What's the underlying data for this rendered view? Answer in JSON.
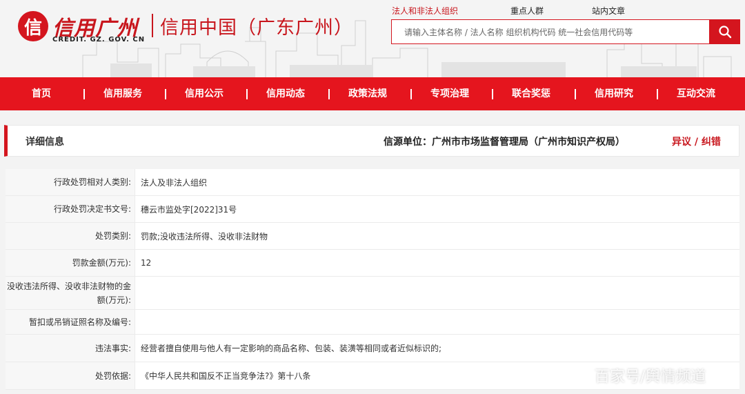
{
  "header": {
    "logo_mark": "信",
    "logo_text": "信用广州",
    "logo_sub": "信用中国（广东广州）",
    "logo_domain": "CREDIT. GZ. GOV. CN"
  },
  "search": {
    "tabs": [
      "法人和非法人组织",
      "重点人群",
      "站内文章"
    ],
    "active_tab": "法人和非法人组织",
    "placeholder": "请输入主体名称 / 法人名称  组织机构代码 统一社会信用代码等"
  },
  "nav": {
    "items": [
      "首页",
      "信用服务",
      "信用公示",
      "信用动态",
      "政策法规",
      "专项治理",
      "联合奖惩",
      "信用研究",
      "互动交流"
    ]
  },
  "panel": {
    "title": "详细信息",
    "source": "信源单位：广州市市场监督管理局（广州市知识产权局）",
    "report_link": "异议 / 纠错"
  },
  "details": [
    {
      "label": "行政处罚相对人类别:",
      "value": "法人及非法人组织"
    },
    {
      "label": "行政处罚决定书文号:",
      "value": "穗云市监处字[2022]31号"
    },
    {
      "label": "处罚类别:",
      "value": "罚款;没收违法所得、没收非法财物"
    },
    {
      "label": "罚款金额(万元):",
      "value": "12"
    },
    {
      "label": "没收违法所得、没收非法财物的金额(万元):",
      "value": ""
    },
    {
      "label": "暂扣或吊销证照名称及编号:",
      "value": ""
    },
    {
      "label": "违法事实:",
      "value": "经营者擅自使用与他人有一定影响的商品名称、包装、装潢等相同或者近似标识的;"
    },
    {
      "label": "处罚依据:",
      "value": "《中华人民共和国反不正当竞争法?》第十八条"
    }
  ],
  "watermark": "百家号/舆情频道",
  "colors": {
    "brand_red": "#d4151e",
    "nav_red": "#e5151e",
    "label_bg": "#f7f7f7"
  }
}
